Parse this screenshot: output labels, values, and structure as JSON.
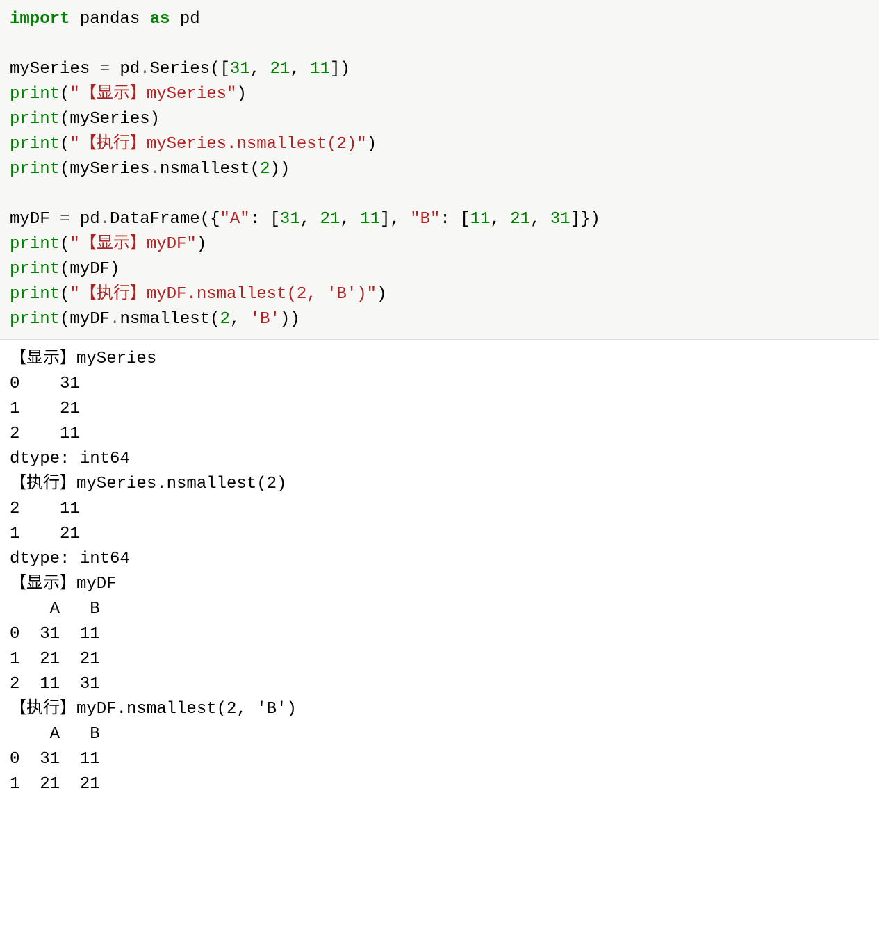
{
  "code": {
    "l1": {
      "import": "import",
      "pandas": " pandas ",
      "as": "as",
      "pd": " pd"
    },
    "l3": {
      "var": "mySeries ",
      "eq": "=",
      "pdseries": " pd",
      "dot": ".",
      "series": "Series([",
      "n1": "31",
      "c1": ", ",
      "n2": "21",
      "c2": ", ",
      "n3": "11",
      "close": "])"
    },
    "l4": {
      "print": "print",
      "open": "(",
      "str": "\"【显示】mySeries\"",
      "close": ")"
    },
    "l5": {
      "print": "print",
      "open": "(mySeries)",
      "close": ""
    },
    "l6": {
      "print": "print",
      "open": "(",
      "str": "\"【执行】mySeries.nsmallest(2)\"",
      "close": ")"
    },
    "l7": {
      "print": "print",
      "open": "(mySeries",
      "dot": ".",
      "fn": "nsmallest(",
      "n": "2",
      "close": "))"
    },
    "l9": {
      "var": "myDF ",
      "eq": "=",
      "pd": " pd",
      "dot": ".",
      "df": "DataFrame({",
      "kA": "\"A\"",
      "col": ": [",
      "n1": "31",
      "c1": ", ",
      "n2": "21",
      "c2": ", ",
      "n3": "11",
      "mid": "], ",
      "kB": "\"B\"",
      "col2": ": [",
      "n4": "11",
      "c3": ", ",
      "n5": "21",
      "c4": ", ",
      "n6": "31",
      "close": "]})"
    },
    "l10": {
      "print": "print",
      "open": "(",
      "str": "\"【显示】myDF\"",
      "close": ")"
    },
    "l11": {
      "print": "print",
      "open": "(myDF)"
    },
    "l12": {
      "print": "print",
      "open": "(",
      "str": "\"【执行】myDF.nsmallest(2, 'B')\"",
      "close": ")"
    },
    "l13": {
      "print": "print",
      "open": "(myDF",
      "dot": ".",
      "fn": "nsmallest(",
      "n": "2",
      "c": ", ",
      "str": "'B'",
      "close": "))"
    }
  },
  "output": {
    "l1": "【显示】mySeries",
    "l2": "0    31",
    "l3": "1    21",
    "l4": "2    11",
    "l5": "dtype: int64",
    "l6": "【执行】mySeries.nsmallest(2)",
    "l7": "2    11",
    "l8": "1    21",
    "l9": "dtype: int64",
    "l10": "【显示】myDF",
    "l11": "    A   B",
    "l12": "0  31  11",
    "l13": "1  21  21",
    "l14": "2  11  31",
    "l15": "【执行】myDF.nsmallest(2, 'B')",
    "l16": "    A   B",
    "l17": "0  31  11",
    "l18": "1  21  21"
  }
}
